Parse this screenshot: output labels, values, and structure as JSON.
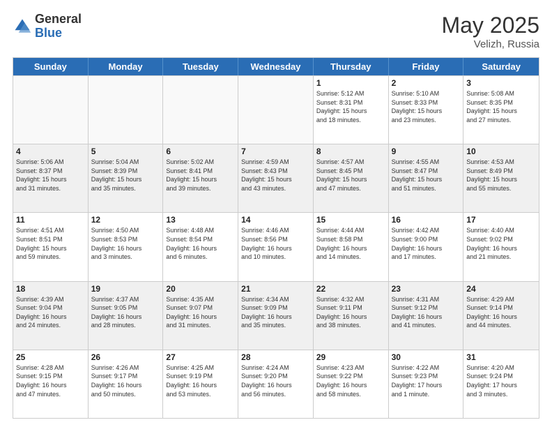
{
  "header": {
    "logo_general": "General",
    "logo_blue": "Blue",
    "title_month": "May 2025",
    "title_location": "Velizh, Russia"
  },
  "weekdays": [
    "Sunday",
    "Monday",
    "Tuesday",
    "Wednesday",
    "Thursday",
    "Friday",
    "Saturday"
  ],
  "rows": [
    [
      {
        "day": "",
        "info": ""
      },
      {
        "day": "",
        "info": ""
      },
      {
        "day": "",
        "info": ""
      },
      {
        "day": "",
        "info": ""
      },
      {
        "day": "1",
        "info": "Sunrise: 5:12 AM\nSunset: 8:31 PM\nDaylight: 15 hours\nand 18 minutes."
      },
      {
        "day": "2",
        "info": "Sunrise: 5:10 AM\nSunset: 8:33 PM\nDaylight: 15 hours\nand 23 minutes."
      },
      {
        "day": "3",
        "info": "Sunrise: 5:08 AM\nSunset: 8:35 PM\nDaylight: 15 hours\nand 27 minutes."
      }
    ],
    [
      {
        "day": "4",
        "info": "Sunrise: 5:06 AM\nSunset: 8:37 PM\nDaylight: 15 hours\nand 31 minutes."
      },
      {
        "day": "5",
        "info": "Sunrise: 5:04 AM\nSunset: 8:39 PM\nDaylight: 15 hours\nand 35 minutes."
      },
      {
        "day": "6",
        "info": "Sunrise: 5:02 AM\nSunset: 8:41 PM\nDaylight: 15 hours\nand 39 minutes."
      },
      {
        "day": "7",
        "info": "Sunrise: 4:59 AM\nSunset: 8:43 PM\nDaylight: 15 hours\nand 43 minutes."
      },
      {
        "day": "8",
        "info": "Sunrise: 4:57 AM\nSunset: 8:45 PM\nDaylight: 15 hours\nand 47 minutes."
      },
      {
        "day": "9",
        "info": "Sunrise: 4:55 AM\nSunset: 8:47 PM\nDaylight: 15 hours\nand 51 minutes."
      },
      {
        "day": "10",
        "info": "Sunrise: 4:53 AM\nSunset: 8:49 PM\nDaylight: 15 hours\nand 55 minutes."
      }
    ],
    [
      {
        "day": "11",
        "info": "Sunrise: 4:51 AM\nSunset: 8:51 PM\nDaylight: 15 hours\nand 59 minutes."
      },
      {
        "day": "12",
        "info": "Sunrise: 4:50 AM\nSunset: 8:53 PM\nDaylight: 16 hours\nand 3 minutes."
      },
      {
        "day": "13",
        "info": "Sunrise: 4:48 AM\nSunset: 8:54 PM\nDaylight: 16 hours\nand 6 minutes."
      },
      {
        "day": "14",
        "info": "Sunrise: 4:46 AM\nSunset: 8:56 PM\nDaylight: 16 hours\nand 10 minutes."
      },
      {
        "day": "15",
        "info": "Sunrise: 4:44 AM\nSunset: 8:58 PM\nDaylight: 16 hours\nand 14 minutes."
      },
      {
        "day": "16",
        "info": "Sunrise: 4:42 AM\nSunset: 9:00 PM\nDaylight: 16 hours\nand 17 minutes."
      },
      {
        "day": "17",
        "info": "Sunrise: 4:40 AM\nSunset: 9:02 PM\nDaylight: 16 hours\nand 21 minutes."
      }
    ],
    [
      {
        "day": "18",
        "info": "Sunrise: 4:39 AM\nSunset: 9:04 PM\nDaylight: 16 hours\nand 24 minutes."
      },
      {
        "day": "19",
        "info": "Sunrise: 4:37 AM\nSunset: 9:05 PM\nDaylight: 16 hours\nand 28 minutes."
      },
      {
        "day": "20",
        "info": "Sunrise: 4:35 AM\nSunset: 9:07 PM\nDaylight: 16 hours\nand 31 minutes."
      },
      {
        "day": "21",
        "info": "Sunrise: 4:34 AM\nSunset: 9:09 PM\nDaylight: 16 hours\nand 35 minutes."
      },
      {
        "day": "22",
        "info": "Sunrise: 4:32 AM\nSunset: 9:11 PM\nDaylight: 16 hours\nand 38 minutes."
      },
      {
        "day": "23",
        "info": "Sunrise: 4:31 AM\nSunset: 9:12 PM\nDaylight: 16 hours\nand 41 minutes."
      },
      {
        "day": "24",
        "info": "Sunrise: 4:29 AM\nSunset: 9:14 PM\nDaylight: 16 hours\nand 44 minutes."
      }
    ],
    [
      {
        "day": "25",
        "info": "Sunrise: 4:28 AM\nSunset: 9:15 PM\nDaylight: 16 hours\nand 47 minutes."
      },
      {
        "day": "26",
        "info": "Sunrise: 4:26 AM\nSunset: 9:17 PM\nDaylight: 16 hours\nand 50 minutes."
      },
      {
        "day": "27",
        "info": "Sunrise: 4:25 AM\nSunset: 9:19 PM\nDaylight: 16 hours\nand 53 minutes."
      },
      {
        "day": "28",
        "info": "Sunrise: 4:24 AM\nSunset: 9:20 PM\nDaylight: 16 hours\nand 56 minutes."
      },
      {
        "day": "29",
        "info": "Sunrise: 4:23 AM\nSunset: 9:22 PM\nDaylight: 16 hours\nand 58 minutes."
      },
      {
        "day": "30",
        "info": "Sunrise: 4:22 AM\nSunset: 9:23 PM\nDaylight: 17 hours\nand 1 minute."
      },
      {
        "day": "31",
        "info": "Sunrise: 4:20 AM\nSunset: 9:24 PM\nDaylight: 17 hours\nand 3 minutes."
      }
    ]
  ]
}
